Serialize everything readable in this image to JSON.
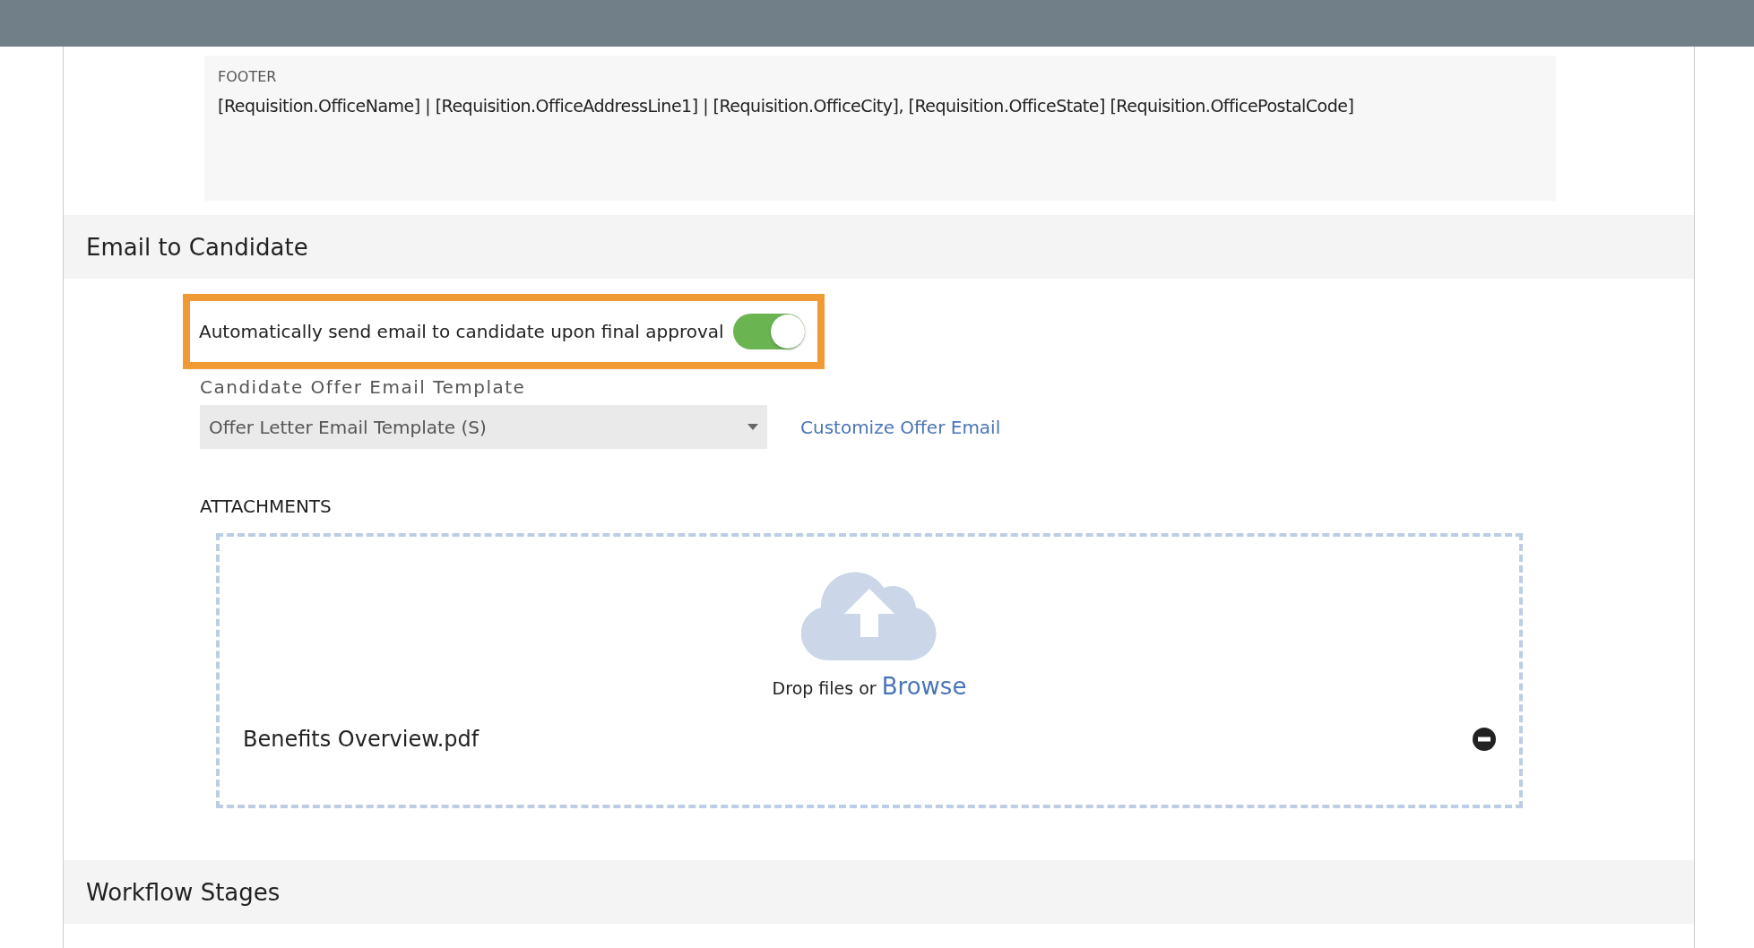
{
  "footer": {
    "label": "FOOTER",
    "value": "[Requisition.OfficeName] | [Requisition.OfficeAddressLine1] | [Requisition.OfficeCity], [Requisition.OfficeState] [Requisition.OfficePostalCode]"
  },
  "email_section": {
    "title": "Email to Candidate",
    "auto_send": {
      "label": "Automatically send email to candidate upon final approval",
      "on": true,
      "highlighted": true
    },
    "template": {
      "label": "Candidate Offer Email Template",
      "value": "Offer Letter Email Template (S)"
    },
    "customize_link": "Customize Offer Email",
    "attachments": {
      "label": "ATTACHMENTS",
      "drop_text": "Drop files or",
      "browse": "Browse",
      "files": [
        {
          "name": "Benefits Overview.pdf"
        }
      ]
    }
  },
  "next_section": {
    "title": "Workflow Stages"
  }
}
